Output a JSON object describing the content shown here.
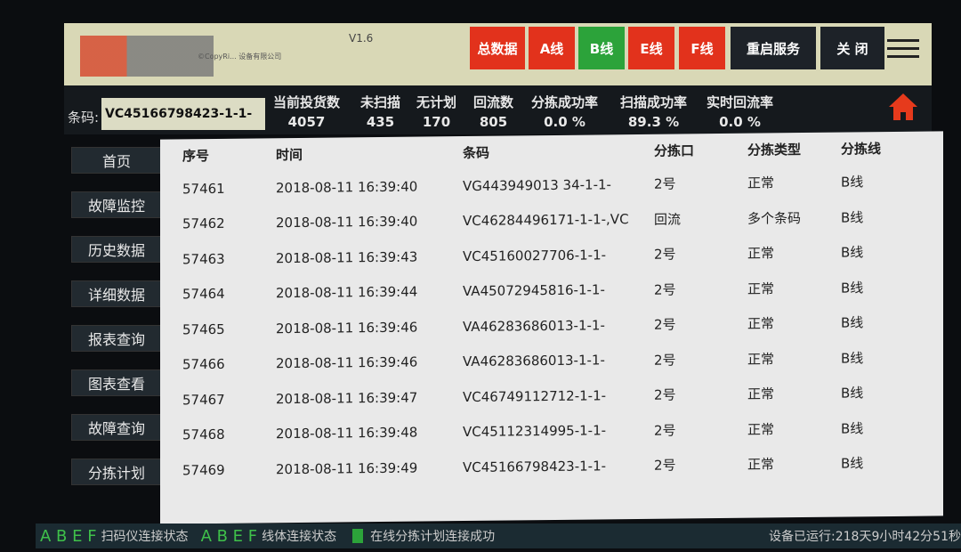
{
  "header": {
    "title": "V1.6",
    "copyright": "©CopyRi... 设备有限公司",
    "buttons": [
      "总数据",
      "A线",
      "B线",
      "E线",
      "F线",
      "重启服务",
      "关 闭"
    ]
  },
  "barcode": {
    "label": "条码:",
    "value": "VC45166798423-1-1-"
  },
  "stats": [
    {
      "label": "当前投货数",
      "value": "4057"
    },
    {
      "label": "未扫描",
      "value": "435"
    },
    {
      "label": "无计划",
      "value": "170"
    },
    {
      "label": "回流数",
      "value": "805"
    },
    {
      "label": "分拣成功率",
      "value": "0.0 %"
    },
    {
      "label": "扫描成功率",
      "value": "89.3 %"
    },
    {
      "label": "实时回流率",
      "value": "0.0 %"
    }
  ],
  "sidebar": [
    "首页",
    "故障监控",
    "历史数据",
    "详细数据",
    "报表查询",
    "图表查看",
    "故障查询",
    "分拣计划"
  ],
  "table": {
    "headers": [
      "序号",
      "时间",
      "条码",
      "分拣口",
      "分拣类型",
      "分拣线"
    ],
    "rows": [
      [
        "57461",
        "2018-08-11 16:39:40",
        "VG443949013 34-1-1-",
        "2号",
        "正常",
        "B线"
      ],
      [
        "57462",
        "2018-08-11 16:39:40",
        "VC46284496171-1-1-,VC",
        "回流",
        "多个条码",
        "B线"
      ],
      [
        "57463",
        "2018-08-11 16:39:43",
        "VC45160027706-1-1-",
        "2号",
        "正常",
        "B线"
      ],
      [
        "57464",
        "2018-08-11 16:39:44",
        "VA45072945816-1-1-",
        "2号",
        "正常",
        "B线"
      ],
      [
        "57465",
        "2018-08-11 16:39:46",
        "VA46283686013-1-1-",
        "2号",
        "正常",
        "B线"
      ],
      [
        "57466",
        "2018-08-11 16:39:46",
        "VA46283686013-1-1-",
        "2号",
        "正常",
        "B线"
      ],
      [
        "57467",
        "2018-08-11 16:39:47",
        "VC46749112712-1-1-",
        "2号",
        "正常",
        "B线"
      ],
      [
        "57468",
        "2018-08-11 16:39:48",
        "VC45112314995-1-1-",
        "2号",
        "正常",
        "B线"
      ],
      [
        "57469",
        "2018-08-11 16:39:49",
        "VC45166798423-1-1-",
        "2号",
        "正常",
        "B线"
      ]
    ]
  },
  "status": {
    "letters1": "A B E F",
    "scanner": "扫码仪连接状态",
    "letters2": "A B E F",
    "line": "线体连接状态",
    "plan": "在线分拣计划连接成功",
    "uptime": "设备已运行:218天9小时42分51秒"
  }
}
